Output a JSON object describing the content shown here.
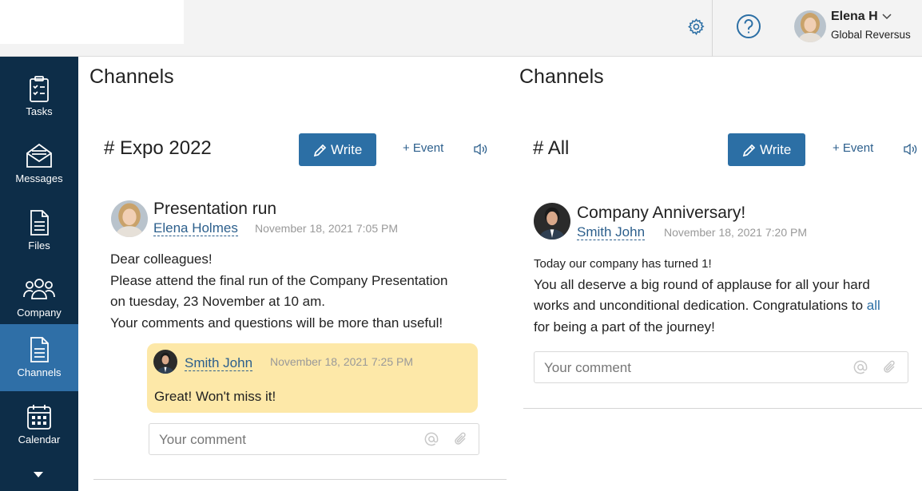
{
  "header": {
    "user": {
      "name": "Elena H",
      "organization": "Global Reversus"
    },
    "icons": [
      "gear-icon",
      "help-icon",
      "chevron-down-icon"
    ]
  },
  "sidebar": {
    "items": [
      {
        "label": "Tasks",
        "icon": "tasks-icon",
        "active": false
      },
      {
        "label": "Messages",
        "icon": "messages-icon",
        "active": false
      },
      {
        "label": "Files",
        "icon": "files-icon",
        "active": false
      },
      {
        "label": "Company",
        "icon": "company-icon",
        "active": false
      },
      {
        "label": "Channels",
        "icon": "channels-icon",
        "active": true
      },
      {
        "label": "Calendar",
        "icon": "calendar-icon",
        "active": false
      }
    ]
  },
  "columns": [
    {
      "page_title": "Channels",
      "channel_name": "# Expo 2022",
      "write_label": "Write",
      "event_label": "+ Event",
      "post": {
        "title": "Presentation run",
        "author": "Elena Holmes",
        "date": "November 18, 2021 7:05 PM",
        "lines": [
          "Dear colleagues!",
          "Please attend the final run of the Company Presentation",
          "on tuesday, 23 November at 10 am.",
          "Your comments and questions will be more than useful!"
        ]
      },
      "reply": {
        "author": "Smith John",
        "date": "November 18, 2021 7:25 PM",
        "text": "Great! Won't miss it!"
      },
      "comment_placeholder": "Your comment"
    },
    {
      "page_title": "Channels",
      "channel_name": "# All",
      "write_label": "Write",
      "event_label": "+ Event",
      "post": {
        "title": "Company Anniversary!",
        "author": "Smith John",
        "date": "November 18, 2021 7:20 PM",
        "lines": [
          "Today our company has turned 1!",
          "You all deserve a big round of applause for all your hard",
          "works and unconditional dedication. Congratulations to",
          "for being a part of the journey!"
        ],
        "link_text": "all"
      },
      "comment_placeholder": "Your comment"
    }
  ],
  "colors": {
    "sidebar": "#0d2d48",
    "active": "#2f6fa7",
    "accent": "#2c6fa5",
    "reply_bg": "#fde8a8"
  }
}
